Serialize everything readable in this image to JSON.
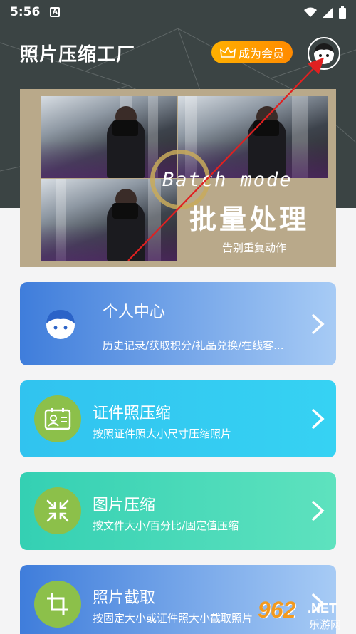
{
  "status_bar": {
    "time": "5:56",
    "notification_icon": "A"
  },
  "header": {
    "title": "照片压缩工厂",
    "vip_button": "成为会员",
    "avatar": "user-avatar-icon"
  },
  "banner": {
    "tagline_en": "Batch mode",
    "title": "批量处理",
    "subtitle": "告别重复动作"
  },
  "cards": {
    "personal": {
      "title": "个人中心",
      "subtitle": "历史记录/获取积分/礼品兑换/在线客..."
    },
    "id_photo": {
      "title": "证件照压缩",
      "subtitle": "按照证件照大小尺寸压缩照片"
    },
    "image": {
      "title": "图片压缩",
      "subtitle": "按文件大小/百分比/固定值压缩"
    },
    "crop": {
      "title": "照片截取",
      "subtitle": "按固定大小或证件照大小截取照片"
    }
  },
  "watermark": {
    "number": "962",
    "net": ".NET",
    "site": "乐游网"
  },
  "colors": {
    "header": "#3b4444",
    "vip": "#ff9a00",
    "green_circle": "#8cc04a",
    "annotation": "#e02020"
  }
}
